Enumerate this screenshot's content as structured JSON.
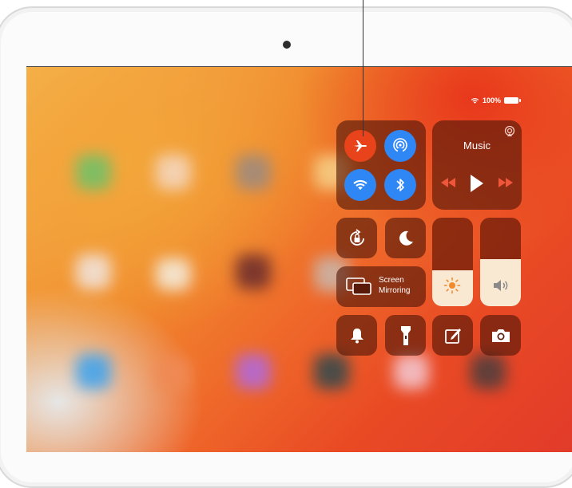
{
  "status_bar": {
    "battery_percent": "100%",
    "icons": [
      "wifi-icon",
      "battery-icon"
    ]
  },
  "control_center": {
    "connectivity": {
      "airplane_mode": {
        "icon": "airplane-icon",
        "active": true,
        "color": "#e8431a"
      },
      "airdrop": {
        "icon": "airdrop-icon",
        "active": true,
        "color": "#2f87f5"
      },
      "wifi": {
        "icon": "wifi-icon",
        "active": true,
        "color": "#2f87f5"
      },
      "bluetooth": {
        "icon": "bluetooth-icon",
        "active": true,
        "color": "#2f87f5"
      }
    },
    "music": {
      "title": "Music",
      "controls": [
        "rewind-icon",
        "play-icon",
        "fast-forward-icon",
        "airplay-icon"
      ]
    },
    "orientation_lock": {
      "icon": "orientation-lock-icon"
    },
    "do_not_disturb": {
      "icon": "moon-icon"
    },
    "screen_mirroring": {
      "label_line1": "Screen",
      "label_line2": "Mirroring",
      "icon": "screen-mirroring-icon"
    },
    "brightness": {
      "level": 0.41,
      "icon": "sun-icon"
    },
    "volume": {
      "level": 0.53,
      "icon": "speaker-icon"
    },
    "bottom_row": [
      "bell-icon",
      "flashlight-icon",
      "notes-icon",
      "camera-icon"
    ]
  },
  "colors": {
    "tile_bg": "rgba(80,22,8,0.62)",
    "accent_blue": "#2f87f5",
    "accent_orange": "#e8431a",
    "slider_fill": "#f9e9d3"
  }
}
